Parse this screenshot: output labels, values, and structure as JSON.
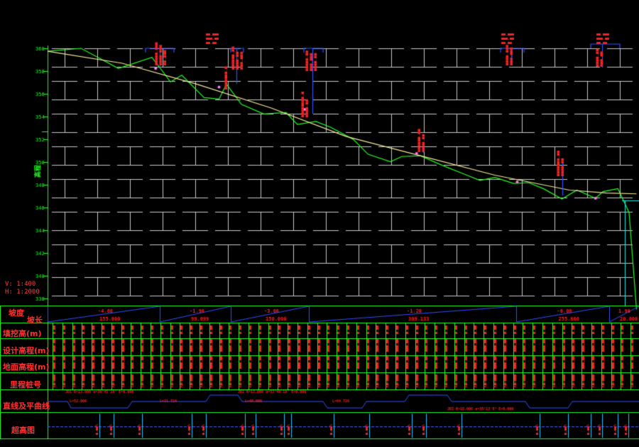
{
  "colors": {
    "background": "#000000",
    "frame": "#22ff22",
    "grid": "#c8c8c8",
    "ground_line": "#22ff22",
    "design_line": "#f5e79c",
    "annotation": "#ff2020",
    "structure": "#3050ff",
    "vertical_curve_point": "#ff77ff",
    "axis_label": "#22ff22"
  },
  "scale": {
    "vertical": "V: 1:400",
    "horizontal": "H: 1:2000"
  },
  "elevation_ticks": [
    "360",
    "358",
    "356",
    "354",
    "352",
    "350",
    "348",
    "346",
    "344",
    "342",
    "340",
    "338"
  ],
  "axis_title": "高程",
  "ground_profile": [
    [
      0,
      0.04
    ],
    [
      0.09,
      0.0
    ],
    [
      0.19,
      0.27
    ],
    [
      0.28,
      0.12
    ],
    [
      0.33,
      0.45
    ],
    [
      0.36,
      0.36
    ],
    [
      0.42,
      0.66
    ],
    [
      0.46,
      0.68
    ],
    [
      0.48,
      0.48
    ],
    [
      0.52,
      0.75
    ],
    [
      0.58,
      0.88
    ],
    [
      0.64,
      0.86
    ],
    [
      0.67,
      1.02
    ],
    [
      0.72,
      0.98
    ],
    [
      0.76,
      1.06
    ],
    [
      0.82,
      1.22
    ],
    [
      0.86,
      1.42
    ],
    [
      0.92,
      1.52
    ],
    [
      0.95,
      1.45
    ],
    [
      1.0,
      1.44
    ],
    [
      1.06,
      1.57
    ],
    [
      1.12,
      1.69
    ],
    [
      1.16,
      1.77
    ],
    [
      1.2,
      1.73
    ],
    [
      1.25,
      1.81
    ],
    [
      1.29,
      1.8
    ],
    [
      1.33,
      1.88
    ],
    [
      1.38,
      2.02
    ],
    [
      1.42,
      1.9
    ],
    [
      1.47,
      2.01
    ],
    [
      1.49,
      1.92
    ],
    [
      1.53,
      1.88
    ],
    [
      1.56,
      2.2
    ],
    [
      1.58,
      3.5
    ]
  ],
  "design_profile": [
    [
      0,
      0.04
    ],
    [
      0.2,
      0.2
    ],
    [
      0.4,
      0.48
    ],
    [
      0.6,
      0.8
    ],
    [
      0.8,
      1.18
    ],
    [
      1.0,
      1.44
    ],
    [
      1.2,
      1.7
    ],
    [
      1.4,
      1.9
    ],
    [
      1.5,
      1.94
    ],
    [
      1.58,
      1.95
    ]
  ],
  "row_labels": {
    "slope": "坡度",
    "length": "坡长",
    "fill_cut": "填挖高(m)",
    "design_elev": "设计高程(m)",
    "ground_elev": "地面高程(m)",
    "stake": "里程桩号",
    "alignment": "直线及平曲线",
    "superelevation": "超高图"
  },
  "grades": [
    {
      "slope": "-4.68",
      "length": "155.000"
    },
    {
      "slope": "-1.98",
      "length": "99.699"
    },
    {
      "slope": "-3.08",
      "length": "150.000"
    },
    {
      "slope": "-1.20",
      "length": "309.133"
    },
    {
      "slope": "-0.08",
      "length": "255.800"
    },
    {
      "slope": "1.98",
      "length": "20.000"
    }
  ],
  "alignment_notes": [
    "JD1 R=13.000 α=30°45'28\" E=0.000",
    "L=52.000",
    "L=21.724",
    "JD2 R=13.000 α=53°40'10\" E=0.000",
    "L=48.000",
    "L=64.726",
    "JD3 R=18.000 α=35°13'8\" E=0.000"
  ]
}
